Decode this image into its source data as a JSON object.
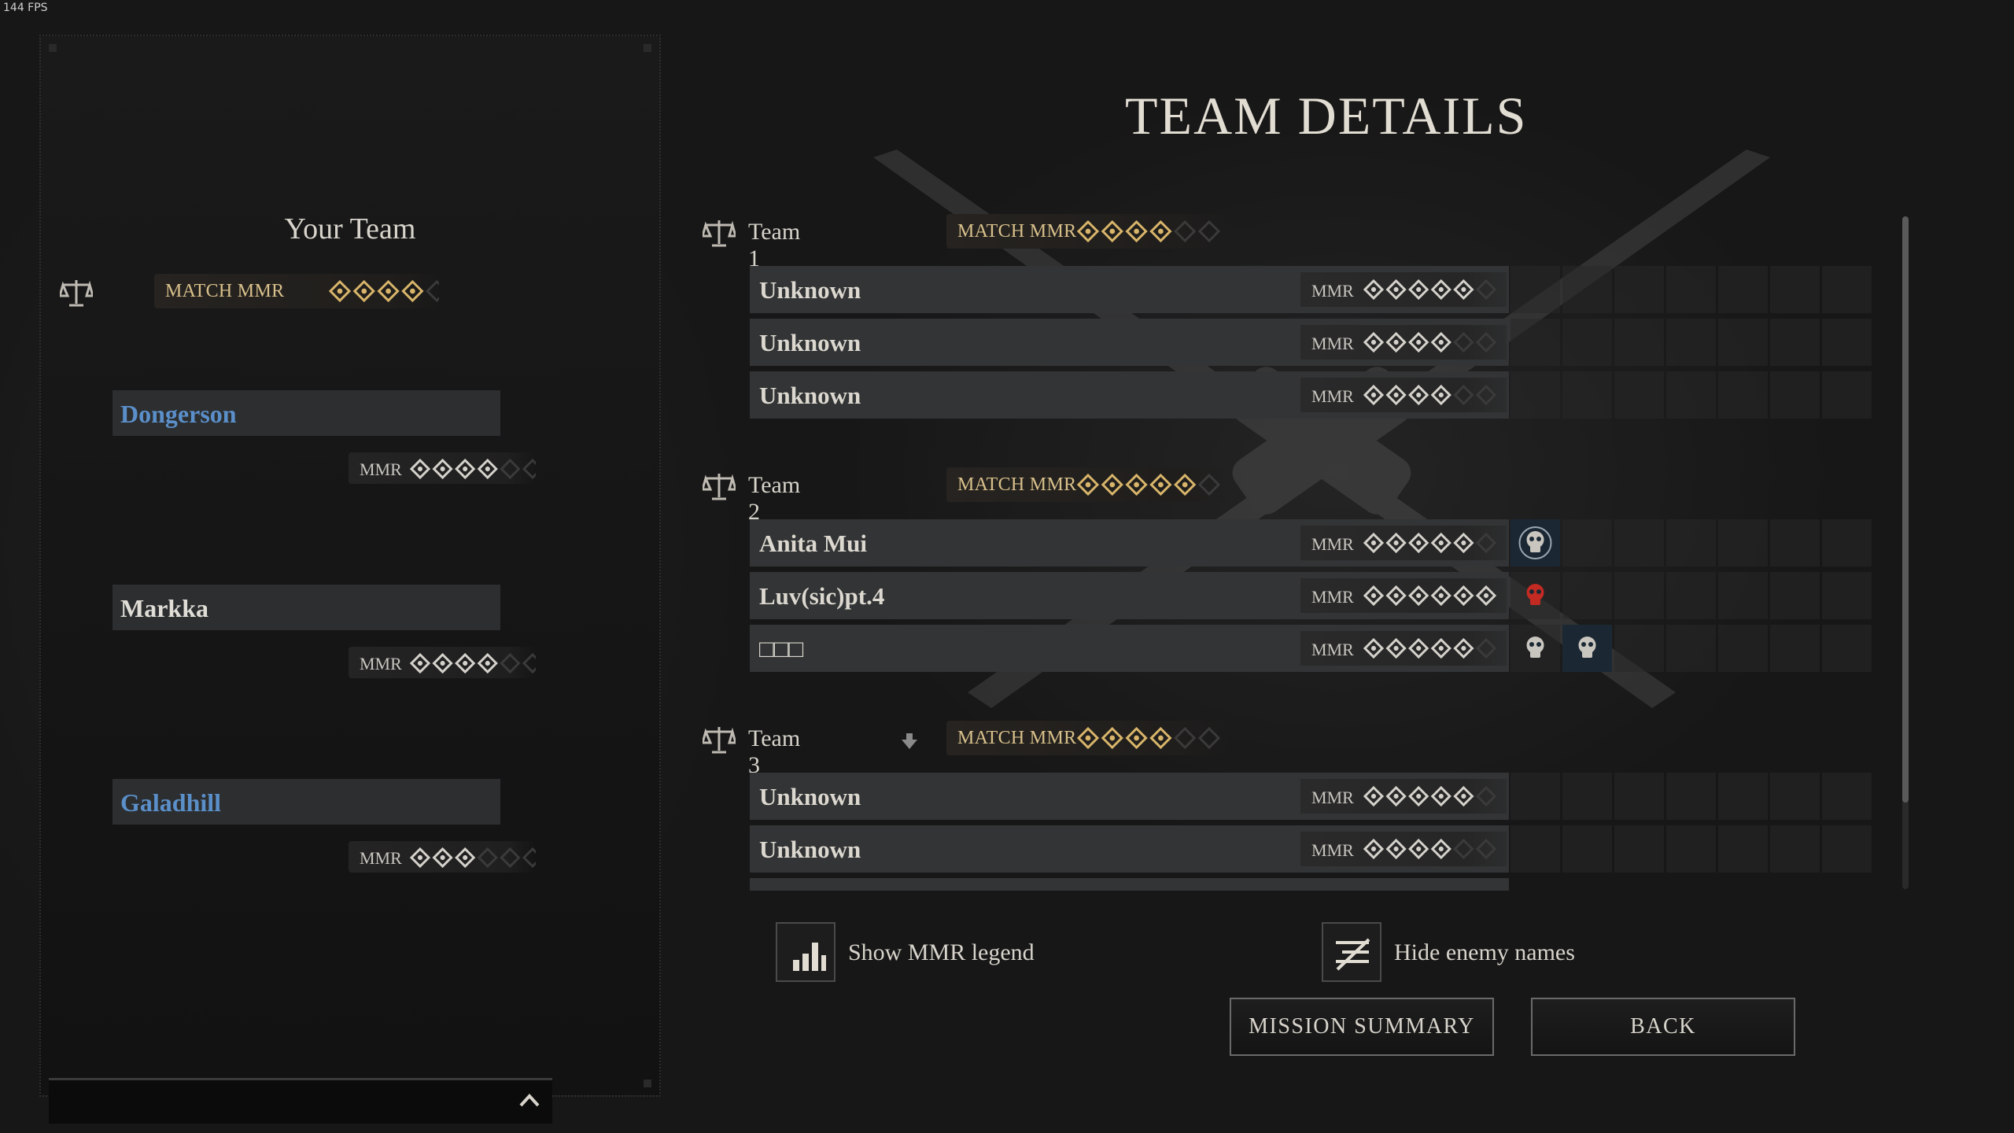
{
  "fps": "144 FPS",
  "title": "TEAM DETAILS",
  "your_team": {
    "title": "Your Team",
    "match_mmr_label": "MATCH MMR",
    "match_stars": 4,
    "players": [
      {
        "name": "Dongerson",
        "color": "#5b8fc9",
        "mmr_label": "MMR",
        "stars": 4
      },
      {
        "name": "Markka",
        "color": "#e0ddd6",
        "mmr_label": "MMR",
        "stars": 4
      },
      {
        "name": "Galadhill",
        "color": "#5b8fc9",
        "mmr_label": "MMR",
        "stars": 3
      }
    ]
  },
  "teams": [
    {
      "label": "Team 1",
      "match_mmr_label": "MATCH MMR",
      "match_stars": 4,
      "players": [
        {
          "name": "Unknown",
          "mmr_label": "MMR",
          "stars": 5,
          "icons": []
        },
        {
          "name": "Unknown",
          "mmr_label": "MMR",
          "stars": 4,
          "icons": []
        },
        {
          "name": "Unknown",
          "mmr_label": "MMR",
          "stars": 4,
          "icons": []
        }
      ]
    },
    {
      "label": "Team 2",
      "match_mmr_label": "MATCH MMR",
      "match_stars": 5,
      "players": [
        {
          "name": "Anita Mui",
          "mmr_label": "MMR",
          "stars": 5,
          "icons": [
            "skull-target-icon"
          ]
        },
        {
          "name": "Luv(sic)pt.4",
          "mmr_label": "MMR",
          "stars": 6,
          "icons": [
            "red-skull-icon"
          ]
        },
        {
          "name": "□□□",
          "mmr_label": "MMR",
          "stars": 5,
          "icons": [
            "skull-icon",
            "skull-icon-blue"
          ]
        }
      ]
    },
    {
      "label": "Team 3",
      "match_mmr_label": "MATCH MMR",
      "match_stars": 4,
      "players": [
        {
          "name": "Unknown",
          "mmr_label": "MMR",
          "stars": 5,
          "icons": []
        },
        {
          "name": "Unknown",
          "mmr_label": "MMR",
          "stars": 4,
          "icons": []
        }
      ]
    }
  ],
  "toggles": {
    "show_mmr_legend": "Show MMR legend",
    "hide_enemy_names": "Hide enemy names"
  },
  "buttons": {
    "mission_summary": "MISSION SUMMARY",
    "back": "BACK"
  },
  "colors": {
    "gold": "#d8b56a",
    "text": "#d8d4cc",
    "blue_name": "#5b8fc9",
    "red_icon": "#c22a22"
  }
}
